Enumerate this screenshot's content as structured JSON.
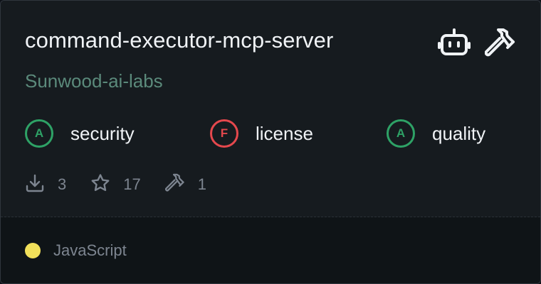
{
  "repo": {
    "name": "command-executor-mcp-server",
    "owner": "Sunwood-ai-labs"
  },
  "header_icons": [
    "robot-icon",
    "hammer-icon"
  ],
  "grades": [
    {
      "grade": "A",
      "label": "security",
      "color": "#2ea266"
    },
    {
      "grade": "F",
      "label": "license",
      "color": "#e5484d"
    },
    {
      "grade": "A",
      "label": "quality",
      "color": "#2ea266"
    }
  ],
  "stats": {
    "downloads": "3",
    "stars": "17",
    "tools": "1"
  },
  "language": {
    "name": "JavaScript",
    "color": "#f1e05a"
  }
}
